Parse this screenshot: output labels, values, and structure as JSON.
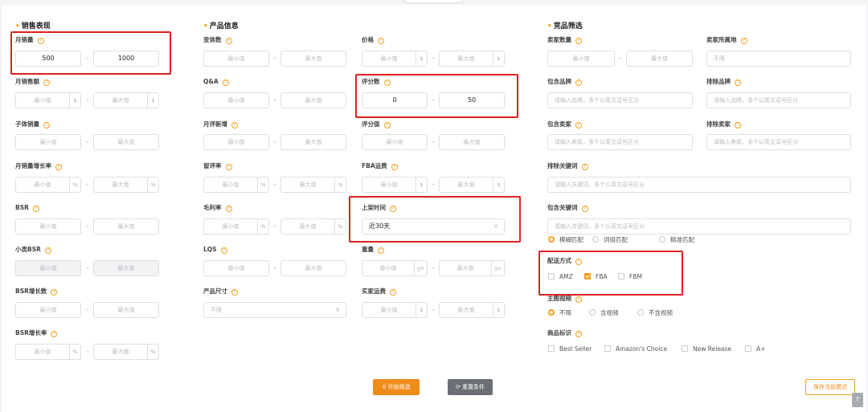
{
  "sections": {
    "sales": "销售表现",
    "product": "产品信息",
    "competitor": "竞品筛选"
  },
  "help_glyph": "?",
  "placeholders": {
    "min": "最小值",
    "max": "最大值",
    "unlimited": "不限",
    "brand": "请输入品牌，多个以英文逗号区分",
    "seller": "请输入卖家，多个以英文逗号区分",
    "keyword": "请输入关键词，多个以英文逗号区分"
  },
  "units": {
    "dollar": "$",
    "percent": "%",
    "gram": "g∨"
  },
  "dash": "–",
  "fields": {
    "monthly_sales": {
      "label": "月销量",
      "min": "500",
      "max": "1000"
    },
    "monthly_revenue": {
      "label": "月销售额"
    },
    "child_sales": {
      "label": "子体销量"
    },
    "sales_growth": {
      "label": "月销量增长率"
    },
    "bsr": {
      "label": "BSR"
    },
    "sub_bsr": {
      "label": "小类BSR"
    },
    "bsr_growth_count": {
      "label": "BSR增长数"
    },
    "bsr_growth_rate": {
      "label": "BSR增长率"
    },
    "variants": {
      "label": "变体数"
    },
    "qa": {
      "label": "Q&A"
    },
    "monthly_new_reviews": {
      "label": "月评新增"
    },
    "review_rate": {
      "label": "留评率"
    },
    "gross_margin": {
      "label": "毛利率"
    },
    "lqs": {
      "label": "LQS"
    },
    "size": {
      "label": "产品尺寸"
    },
    "price": {
      "label": "价格"
    },
    "review_count": {
      "label": "评分数",
      "min": "0",
      "max": "50"
    },
    "rating": {
      "label": "评分值"
    },
    "fba_fee": {
      "label": "FBA运费"
    },
    "listing_time": {
      "label": "上架时间",
      "value": "近30天"
    },
    "weight": {
      "label": "重量"
    },
    "buyer_shipping": {
      "label": "买家运费"
    },
    "seller_count": {
      "label": "卖家数量"
    },
    "seller_location": {
      "label": "卖家所属地"
    },
    "include_brand": {
      "label": "包含品牌"
    },
    "exclude_brand": {
      "label": "排除品牌"
    },
    "include_seller": {
      "label": "包含卖家"
    },
    "exclude_seller": {
      "label": "排除卖家"
    },
    "exclude_keyword": {
      "label": "排除关键词"
    },
    "include_keyword": {
      "label": "包含关键词"
    },
    "match_modes": [
      "模糊匹配",
      "词组匹配",
      "精准匹配"
    ],
    "shipping": {
      "label": "配送方式",
      "options": [
        "AMZ",
        "FBA",
        "FBM"
      ]
    },
    "video": {
      "label": "主图视频",
      "options": [
        "不限",
        "含视频",
        "不含视频"
      ]
    },
    "badges": {
      "label": "商品标识",
      "options": [
        "Best Seller",
        "Amazon's Choice",
        "New Release",
        "A+"
      ]
    }
  },
  "buttons": {
    "start": "开始筛选",
    "reset": "重置条件",
    "save": "保存当前模式",
    "to_top": "↑"
  }
}
